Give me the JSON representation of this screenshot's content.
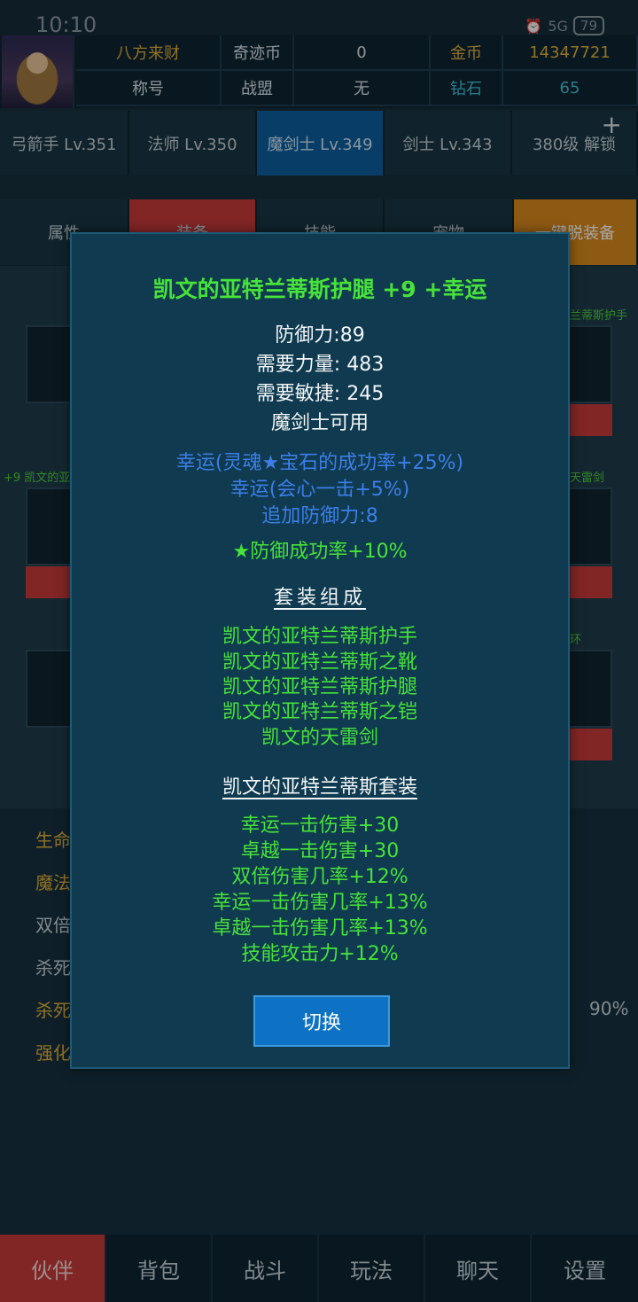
{
  "status": {
    "time": "10:10",
    "signal": "5G",
    "battery": "79"
  },
  "header": {
    "row1": [
      "八方来财",
      "奇迹币",
      "0",
      "金币",
      "14347721"
    ],
    "row2": [
      "称号",
      "战盟",
      "无",
      "钻石",
      "65"
    ]
  },
  "classes": [
    "弓箭手 Lv.351",
    "法师 Lv.350",
    "魔剑士 Lv.349",
    "剑士 Lv.343",
    "380级 解锁"
  ],
  "subtabs": [
    "属性",
    "装备",
    "技能",
    "宠物",
    "一键脱装备"
  ],
  "side_labels": {
    "right1": "兰蒂斯护手",
    "left2": "+9 凯文的亚",
    "right2": "天雷剑",
    "right3": "环"
  },
  "stats_labels": [
    "生命",
    "魔法",
    "双倍",
    "杀死",
    "杀死",
    "强化"
  ],
  "stat_right_value": "90%",
  "nav": [
    "伙伴",
    "背包",
    "战斗",
    "玩法",
    "聊天",
    "设置"
  ],
  "modal": {
    "title": "凯文的亚特兰蒂斯护腿 +9 +幸运",
    "base": [
      "防御力:89",
      "需要力量: 483",
      "需要敏捷: 245",
      "魔剑士可用"
    ],
    "luck": [
      "幸运(灵魂★宝石的成功率+25%)",
      "幸运(会心一击+5%)",
      "追加防御力:8"
    ],
    "extra": "★防御成功率+10%",
    "set_header": "套装组成",
    "set_items": [
      "凯文的亚特兰蒂斯护手",
      "凯文的亚特兰蒂斯之靴",
      "凯文的亚特兰蒂斯护腿",
      "凯文的亚特兰蒂斯之铠",
      "凯文的天雷剑"
    ],
    "set_name": "凯文的亚特兰蒂斯套装",
    "set_bonus": [
      "幸运一击伤害+30",
      "卓越一击伤害+30",
      "双倍伤害几率+12%",
      "幸运一击伤害几率+13%",
      "卓越一击伤害几率+13%",
      "技能攻击力+12%"
    ],
    "switch": "切换"
  }
}
